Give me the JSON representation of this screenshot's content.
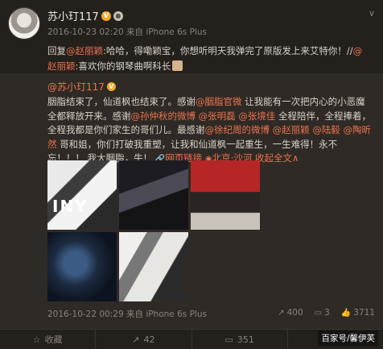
{
  "post": {
    "username": "苏小玎117",
    "v_badge": "V",
    "member_badge": "●",
    "chevron": "∨",
    "time": "2016-10-23 02:20",
    "source_prefix": "来自",
    "source": "iPhone 6s Plus",
    "reply": {
      "prefix": "回复",
      "mention1": "@赵丽颖",
      "text1": ":哈哈，得嘞颖宝，你想听明天我弹完了原版发上来艾特你！//",
      "mention2": "@赵丽颖",
      "text2": ":喜欢你的钢琴曲啊科长"
    }
  },
  "repost": {
    "username": "@苏小玎117",
    "v_badge": "V",
    "text_a": "胭脂结束了，仙道枫也结束了。感谢",
    "m1": "@胭脂官微",
    "text_b": " 让我能有一次把内心的小恶魔全都释放开来。感谢",
    "m2": "@孙仲秋的微博",
    "sp1": " ",
    "m3": "@张明磊",
    "sp2": " ",
    "m4": "@张境佳",
    "text_c": " 全程陪伴，全程捧着，全程我都是你们家生的哥们儿。最感谢",
    "m5": "@徐纪周的微博",
    "sp3": " ",
    "m6": "@赵丽颖",
    "sp4": " ",
    "m7": "@陆毅",
    "sp5": " ",
    "m8": "@陶昕然",
    "text_d": " 哥和姐，你们打破我重塑，让我和仙道枫一起重生，一生难得！永不忘！！！ 我大胭脂，牛！ ",
    "web_link": "网页链接",
    "location": "北京·沙河",
    "collapse": "收起全文",
    "collapse_icon": "∧",
    "photo_text": "INY",
    "time": "2016-10-22 00:29",
    "source_prefix": "来自",
    "source": "iPhone 6s Plus",
    "shares": "400",
    "comments": "3",
    "likes": "3711"
  },
  "actions": {
    "favorite": "收藏",
    "repost": "42",
    "comment": "351"
  },
  "watermark": "百家号/馨伊芙"
}
